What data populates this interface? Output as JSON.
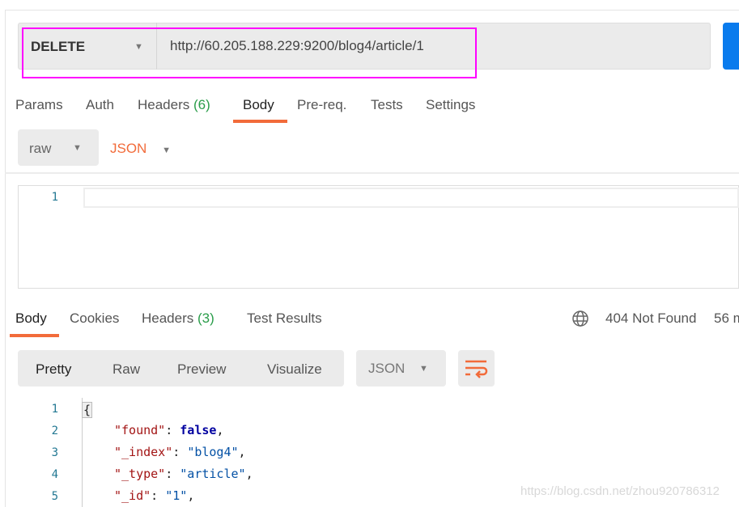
{
  "request": {
    "method": "DELETE",
    "url": "http://60.205.188.229:9200/blog4/article/1"
  },
  "request_tabs": [
    {
      "label": "Params"
    },
    {
      "label": "Auth"
    },
    {
      "label": "Headers",
      "count": "(6)"
    },
    {
      "label": "Body",
      "active": true
    },
    {
      "label": "Pre-req."
    },
    {
      "label": "Tests"
    },
    {
      "label": "Settings"
    }
  ],
  "body_options": {
    "mode": "raw",
    "format": "JSON"
  },
  "editor": {
    "line_numbers": [
      "1"
    ]
  },
  "response_tabs": [
    {
      "label": "Body",
      "active": true
    },
    {
      "label": "Cookies"
    },
    {
      "label": "Headers",
      "count": "(3)"
    },
    {
      "label": "Test Results"
    }
  ],
  "status": {
    "icon": "globe-icon",
    "code": "404 Not Found",
    "time": "56 m"
  },
  "view_modes": [
    "Pretty",
    "Raw",
    "Preview",
    "Visualize"
  ],
  "response_format": "JSON",
  "response_lines": [
    {
      "n": "1",
      "text": "{"
    },
    {
      "n": "2",
      "key": "\"found\"",
      "value": "false",
      "vtype": "bool"
    },
    {
      "n": "3",
      "key": "\"_index\"",
      "value": "\"blog4\"",
      "vtype": "string"
    },
    {
      "n": "4",
      "key": "\"_type\"",
      "value": "\"article\"",
      "vtype": "string"
    },
    {
      "n": "5",
      "key": "\"_id\"",
      "value": "\"1\"",
      "vtype": "string"
    }
  ],
  "watermark": "https://blog.csdn.net/zhou920786312",
  "colors": {
    "accent": "#f26b3a",
    "status": "#2a9d4a",
    "send": "#097bed",
    "highlight": "#ff00ff"
  }
}
